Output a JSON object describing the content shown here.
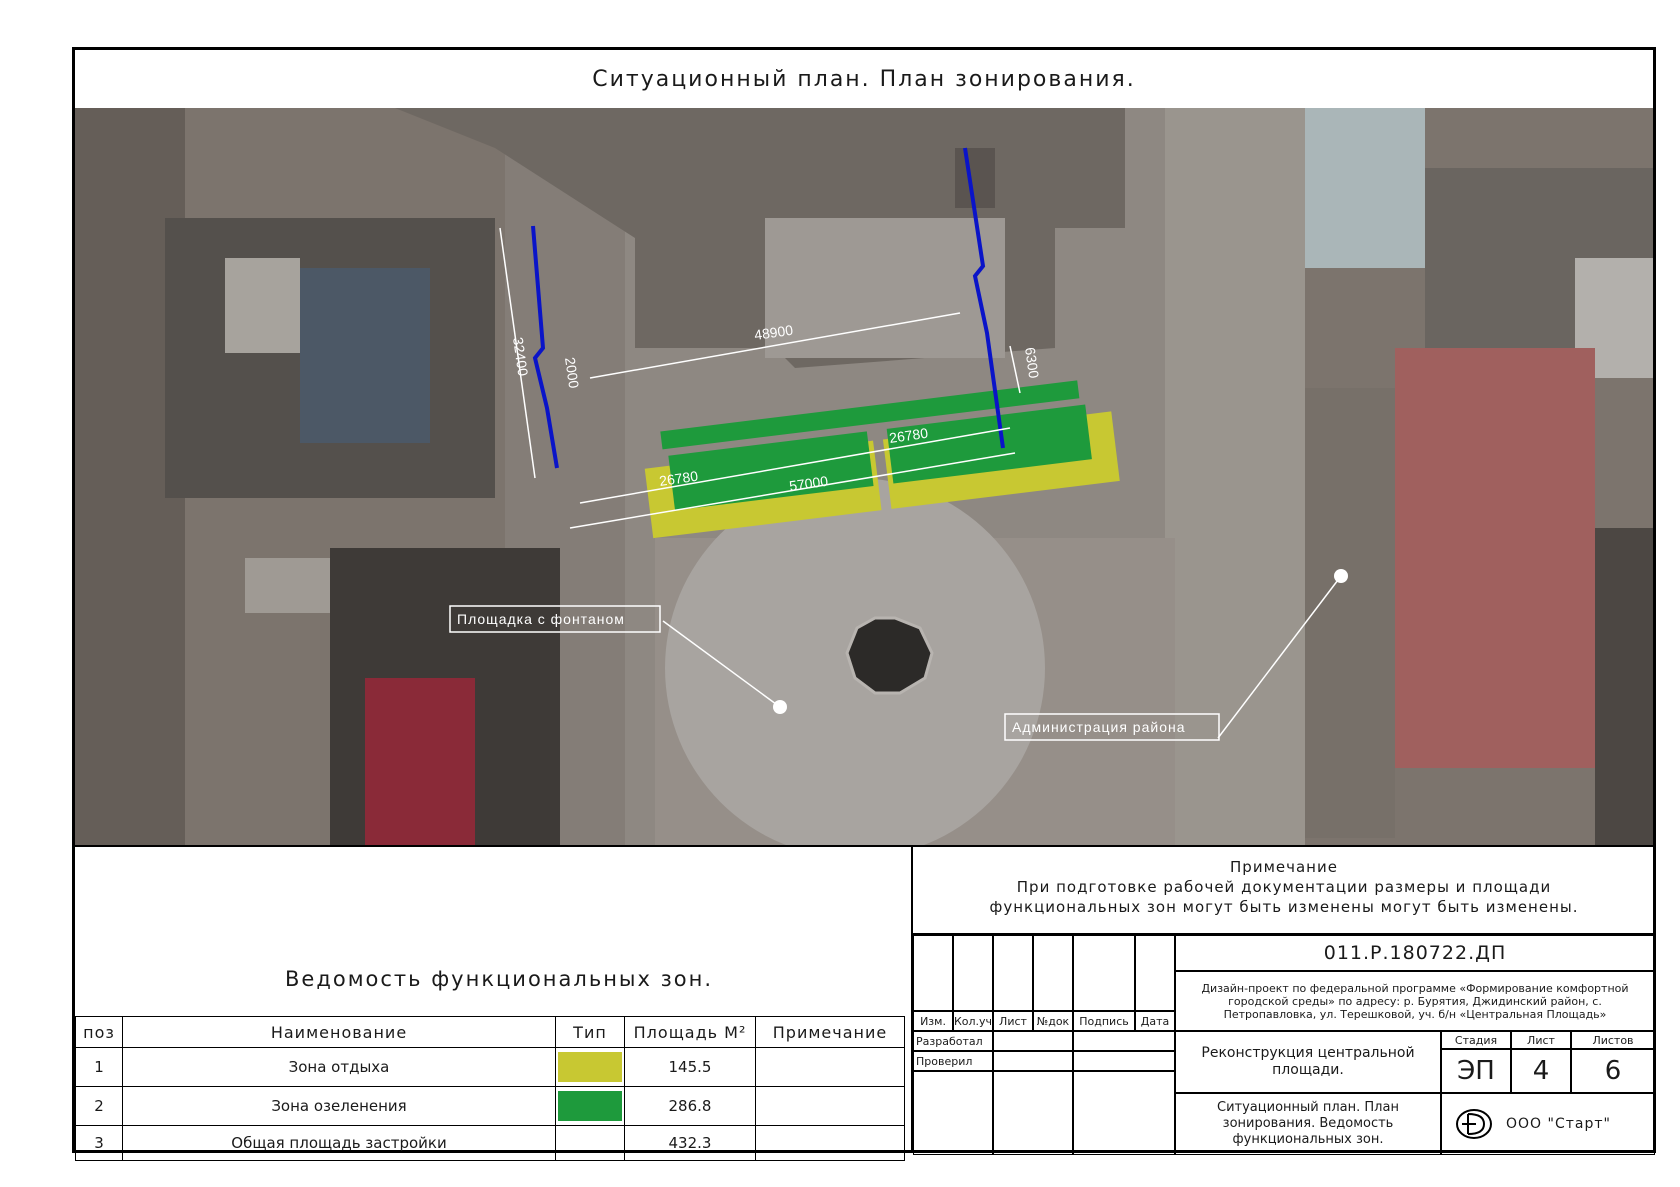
{
  "sheet_title": "Ситуационный план. План зонирования.",
  "map": {
    "dimensions": {
      "total_width": "57000",
      "upper_width": "48900",
      "left_segment": "26780",
      "right_segment": "26780",
      "depth": "32400",
      "strip_gap": "2000",
      "right_depth": "6300"
    },
    "callouts": {
      "fountain": "Площадка с фонтаном",
      "administration": "Администрация района"
    },
    "colors": {
      "rest_zone": "#c8c832",
      "green_zone": "#1e9a3c",
      "boundary": "#0a14c8"
    }
  },
  "zones_table": {
    "title": "Ведомость функциональных зон.",
    "headers": [
      "поз",
      "Наименование",
      "Тип",
      "Площадь М²",
      "Примечание"
    ],
    "rows": [
      {
        "pos": "1",
        "name": "Зона отдыха",
        "color": "#c8c832",
        "area": "145.5",
        "note": ""
      },
      {
        "pos": "2",
        "name": "Зона озеленения",
        "color": "#1e9a3c",
        "area": "286.8",
        "note": ""
      },
      {
        "pos": "3",
        "name": "Общая площадь застройки",
        "color": "",
        "area": "432.3",
        "note": ""
      }
    ]
  },
  "title_block": {
    "note_heading": "Примечание",
    "note_line1": "При подготовке рабочей документации размеры и площади",
    "note_line2": "функциональных зон могут быть изменены могут быть изменены.",
    "doc_code": "011.Р.180722.ДП",
    "project_desc": "Дизайн-проект по федеральной программе «Формирование комфортной городской среды» по адресу: р. Бурятия, Джидинский район, с. Петропавловка, ул. Терешковой, уч. б/н «Центральная Площадь»",
    "columns": [
      "Изм.",
      "Кол.уч",
      "Лист",
      "№док",
      "Подпись",
      "Дата"
    ],
    "roles": [
      "Разработал",
      "Проверил"
    ],
    "object_name": "Реконструкция центральной площади.",
    "sheet_name": "Ситуационный план. План зонирования. Ведомость функциональных зон.",
    "stage_label": "Стадия",
    "sheet_label": "Лист",
    "sheets_label": "Листов",
    "stage": "ЭП",
    "sheet": "4",
    "sheets": "6",
    "company": "ООО \"Старт\""
  }
}
